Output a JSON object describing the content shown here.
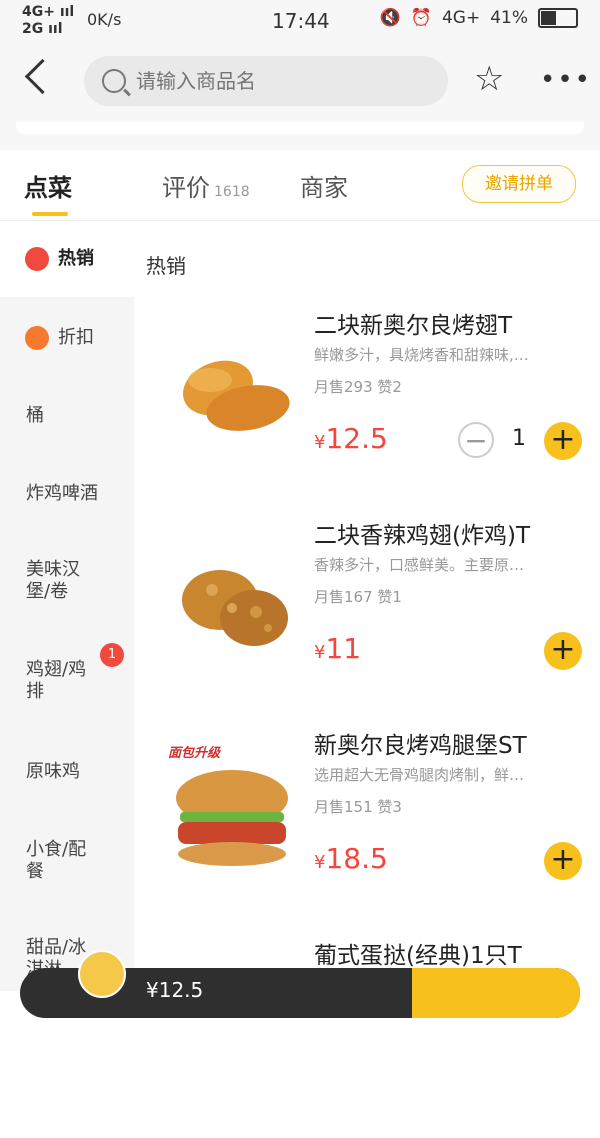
{
  "status_bar": {
    "signal_top": "4G+ ııl",
    "signal_bottom": "2G ııl",
    "speed": "0K/s",
    "time": "17:44",
    "network": "4G+",
    "battery": "41%"
  },
  "header": {
    "search_placeholder": "请输入商品名"
  },
  "tabs": [
    {
      "label": "点菜"
    },
    {
      "label": "评价",
      "count": "1618"
    },
    {
      "label": "商家"
    }
  ],
  "invite_label": "邀请拼单",
  "sidebar": {
    "items": [
      {
        "label": "热销"
      },
      {
        "label": "折扣"
      },
      {
        "label": "桶"
      },
      {
        "label": "炸鸡啤酒"
      },
      {
        "label": "美味汉\n堡/卷"
      },
      {
        "label": "鸡翅/鸡\n排",
        "badge": "1"
      },
      {
        "label": "原味鸡"
      },
      {
        "label": "小食/配\n餐"
      },
      {
        "label": "甜品/冰\n淇淋"
      }
    ]
  },
  "section_title": "热销",
  "dishes": [
    {
      "name": "二块新奥尔良烤翅T",
      "desc": "鲜嫩多汁，具烧烤香和甜辣味,…",
      "stats": "月售293  赞2",
      "price": "12.5",
      "currency": "¥",
      "qty": "1"
    },
    {
      "name": "二块香辣鸡翅(炸鸡)T",
      "desc": "香辣多汁，口感鲜美。主要原…",
      "stats": "月售167  赞1",
      "price": "11",
      "currency": "¥"
    },
    {
      "name": "新奥尔良烤鸡腿堡ST",
      "desc": "选用超大无骨鸡腿肉烤制，鲜…",
      "stats": "月售151  赞3",
      "price": "18.5",
      "currency": "¥",
      "promo_label": "面包升级"
    },
    {
      "name": "葡式蛋挞(经典)1只T"
    }
  ],
  "cart": {
    "total": "¥12.5"
  },
  "colors": {
    "accent": "#f8c01c",
    "price": "#f2473a",
    "badge": "#f04a3e"
  }
}
